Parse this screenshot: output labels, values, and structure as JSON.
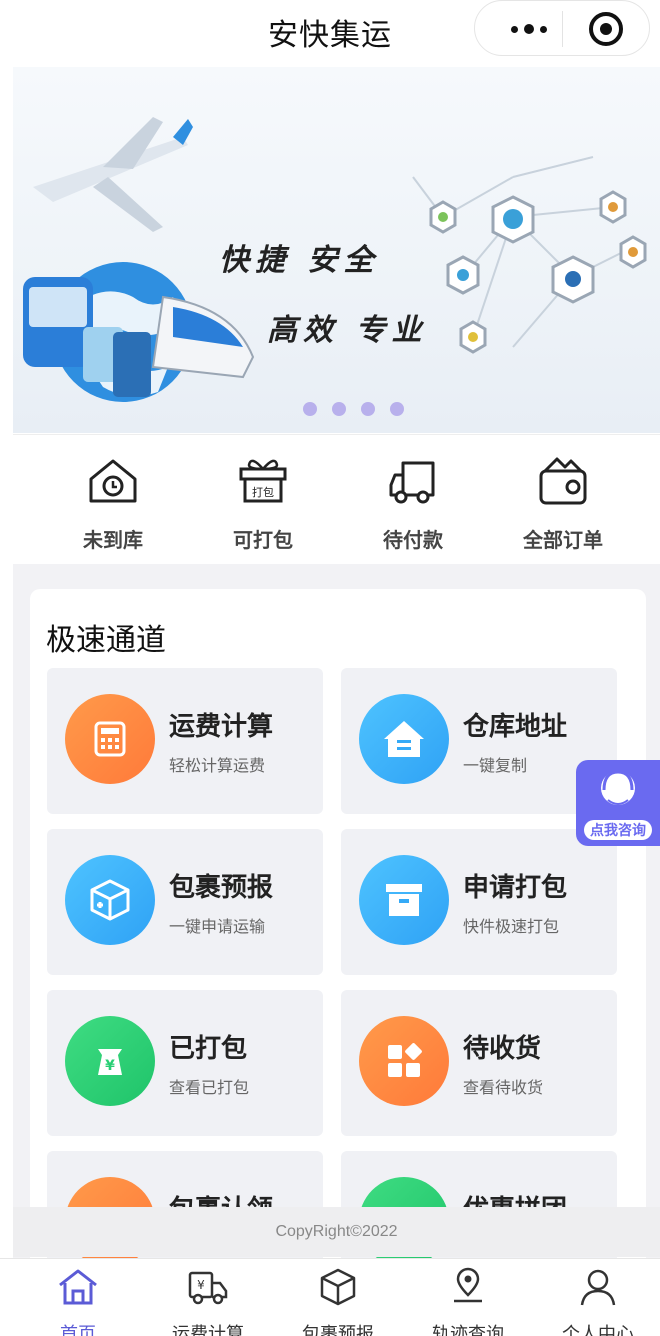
{
  "header": {
    "title": "安快集运"
  },
  "banner": {
    "slogan_line1": "快捷  安全",
    "slogan_line2": "高效  专业",
    "indicator_count": 4
  },
  "quick_orders": [
    {
      "label": "未到库",
      "icon": "warehouse-clock-icon"
    },
    {
      "label": "可打包",
      "icon": "gift-package-icon"
    },
    {
      "label": "待付款",
      "icon": "truck-icon"
    },
    {
      "label": "全部订单",
      "icon": "wallet-icon"
    }
  ],
  "fast_channel": {
    "title": "极速通道",
    "tiles": [
      {
        "title": "运费计算",
        "subtitle": "轻松计算运费",
        "icon": "calculator-icon",
        "color": "orange"
      },
      {
        "title": "仓库地址",
        "subtitle": "一键复制",
        "icon": "house-icon",
        "color": "blue"
      },
      {
        "title": "包裹预报",
        "subtitle": "一键申请运输",
        "icon": "parcel-icon",
        "color": "blue"
      },
      {
        "title": "申请打包",
        "subtitle": "快件极速打包",
        "icon": "archive-box-icon",
        "color": "blue"
      },
      {
        "title": "已打包",
        "subtitle": "查看已打包",
        "icon": "money-bag-icon",
        "color": "green"
      },
      {
        "title": "待收货",
        "subtitle": "查看待收货",
        "icon": "grid-icon",
        "color": "orange"
      },
      {
        "title": "包裹认领",
        "subtitle": "",
        "icon": "claim-icon",
        "color": "orange"
      },
      {
        "title": "优惠拼团",
        "subtitle": "",
        "icon": "group-icon",
        "color": "green"
      }
    ]
  },
  "consult": {
    "label": "点我咨询"
  },
  "footer": {
    "copyright": "CopyRight©2022"
  },
  "tabbar": [
    {
      "label": "首页",
      "icon": "home-icon",
      "active": true
    },
    {
      "label": "运费计算",
      "icon": "freight-icon",
      "active": false
    },
    {
      "label": "包裹预报",
      "icon": "package-icon",
      "active": false
    },
    {
      "label": "轨迹查询",
      "icon": "location-icon",
      "active": false
    },
    {
      "label": "个人中心",
      "icon": "user-icon",
      "active": false
    }
  ],
  "colors": {
    "accent": "#5b5bd6",
    "orange": "#ff8a3d",
    "blue": "#35aaf7",
    "green": "#28cf74"
  }
}
